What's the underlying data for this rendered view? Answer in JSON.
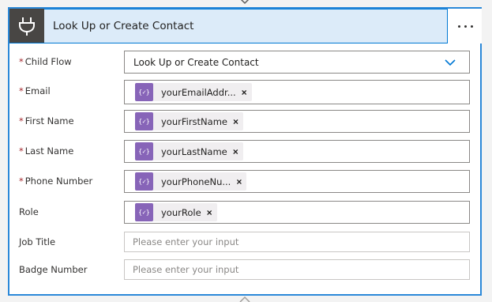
{
  "card": {
    "title": "Look Up or Create Contact",
    "header_icon": "plug-icon",
    "more_icon": "more-ellipsis-icon",
    "accent_color": "#0078d4",
    "header_bg": "#dcebf9"
  },
  "fields": {
    "child_flow": {
      "label": "Child Flow",
      "required": "*",
      "value": "Look Up or Create Contact",
      "icon": "chevron-down-icon"
    },
    "email": {
      "label": "Email",
      "required": "*",
      "token": "yourEmailAddr...",
      "token_icon": "{✓}"
    },
    "first_name": {
      "label": "First Name",
      "required": "*",
      "token": "yourFirstName",
      "token_icon": "{✓}"
    },
    "last_name": {
      "label": "Last Name",
      "required": "*",
      "token": "yourLastName",
      "token_icon": "{✓}"
    },
    "phone_number": {
      "label": "Phone Number",
      "required": "*",
      "token": "yourPhoneNu...",
      "token_icon": "{✓}"
    },
    "role": {
      "label": "Role",
      "token": "yourRole",
      "token_icon": "{✓}"
    },
    "job_title": {
      "label": "Job Title",
      "placeholder": "Please enter your input"
    },
    "badge_number": {
      "label": "Badge Number",
      "placeholder": "Please enter your input"
    }
  },
  "token_close": "×",
  "token_color": "#8764b8",
  "required_color": "#a4262c"
}
